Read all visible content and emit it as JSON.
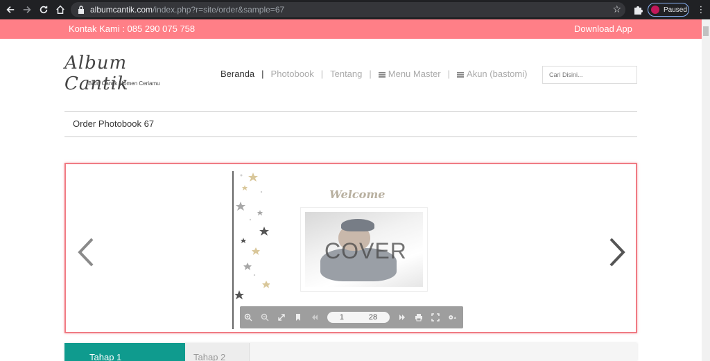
{
  "browser": {
    "url_host": "albumcantik.com",
    "url_path": "/index.php?r=site/order&sample=67",
    "profile_label": "Paused"
  },
  "topbar": {
    "contact": "Kontak Kami : 085 290 075 758",
    "download": "Download App"
  },
  "logo": {
    "name": "Album Cantik",
    "tagline": "Bikin Cantik Momen Ceriamu"
  },
  "nav": {
    "items": [
      {
        "label": "Beranda"
      },
      {
        "label": "Photobook"
      },
      {
        "label": "Tentang"
      },
      {
        "label": "Menu Master"
      },
      {
        "label": "Akun (bastomi)"
      }
    ]
  },
  "search": {
    "placeholder": "Cari Disini..."
  },
  "page": {
    "title": "Order Photobook 67"
  },
  "viewer": {
    "welcome": "Welcome",
    "cover_label": "COVER",
    "current_page": "1",
    "total_pages": "28"
  },
  "steps": [
    {
      "label": "Tahap 1"
    },
    {
      "label": "Tahap 2"
    }
  ],
  "colors": {
    "topbar": "#ff7f87",
    "viewer_border": "#f07b84",
    "step_active": "#0f9b8e"
  }
}
